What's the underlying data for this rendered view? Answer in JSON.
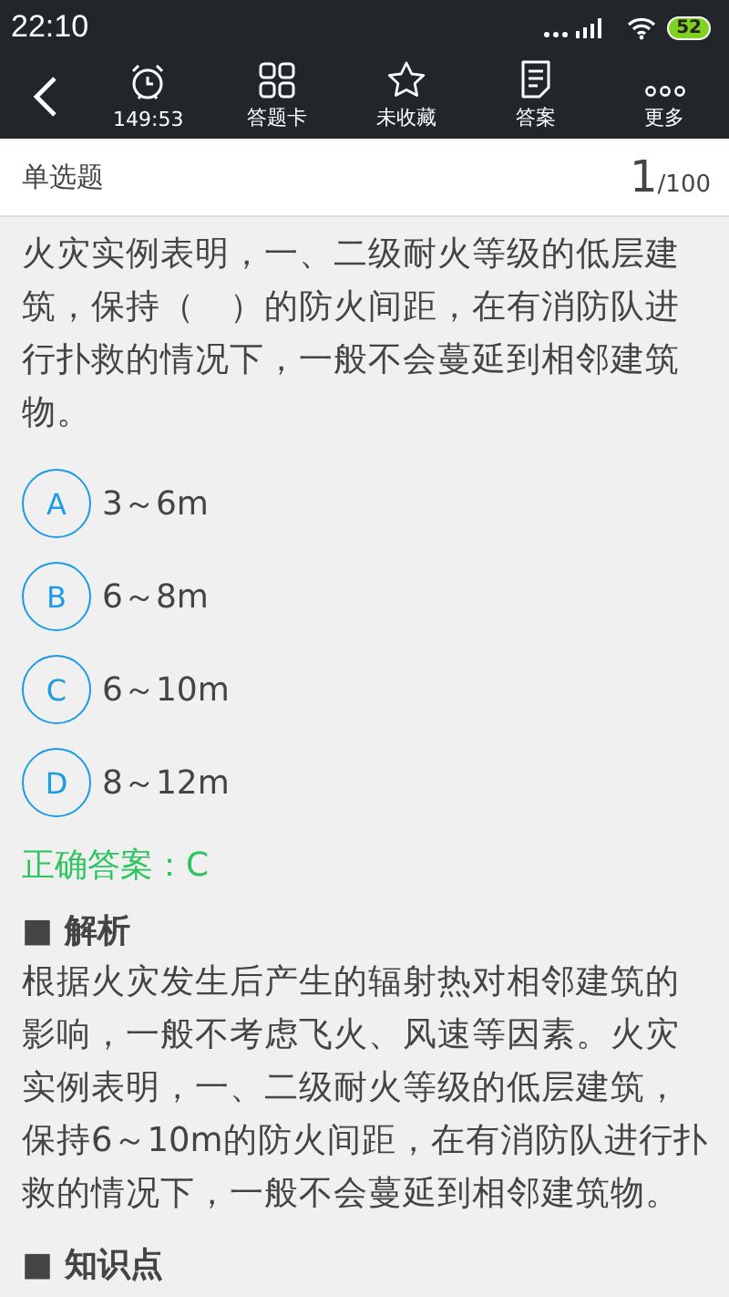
{
  "status_bar": {
    "time": "22:10",
    "battery": "52"
  },
  "toolbar": {
    "items": [
      {
        "kind": "timer",
        "label": "149:53"
      },
      {
        "kind": "card",
        "label": "答题卡"
      },
      {
        "kind": "star",
        "label": "未收藏"
      },
      {
        "kind": "doc",
        "label": "答案"
      },
      {
        "kind": "more",
        "label": "更多"
      }
    ]
  },
  "header": {
    "type": "单选题",
    "current": "1",
    "total": "/100"
  },
  "question": "火灾实例表明，一、二级耐火等级的低层建筑，保持（　）的防火间距，在有消防队进行扑救的情况下，一般不会蔓延到相邻建筑物。",
  "options": [
    {
      "letter": "A",
      "text": "3～6m"
    },
    {
      "letter": "B",
      "text": "6～8m"
    },
    {
      "letter": "C",
      "text": "6～10m"
    },
    {
      "letter": "D",
      "text": "8～12m"
    }
  ],
  "answer": "正确答案：C",
  "sections": [
    {
      "title": "■ 解析",
      "body": "根据火灾发生后产生的辐射热对相邻建筑的影响，一般不考虑飞火、风速等因素。火灾实例表明，一、二级耐火等级的低层建筑，保持6～10m的防火间距，在有消防队进行扑救的情况下，一般不会蔓延到相邻建筑物。"
    },
    {
      "title": "■ 知识点"
    }
  ]
}
